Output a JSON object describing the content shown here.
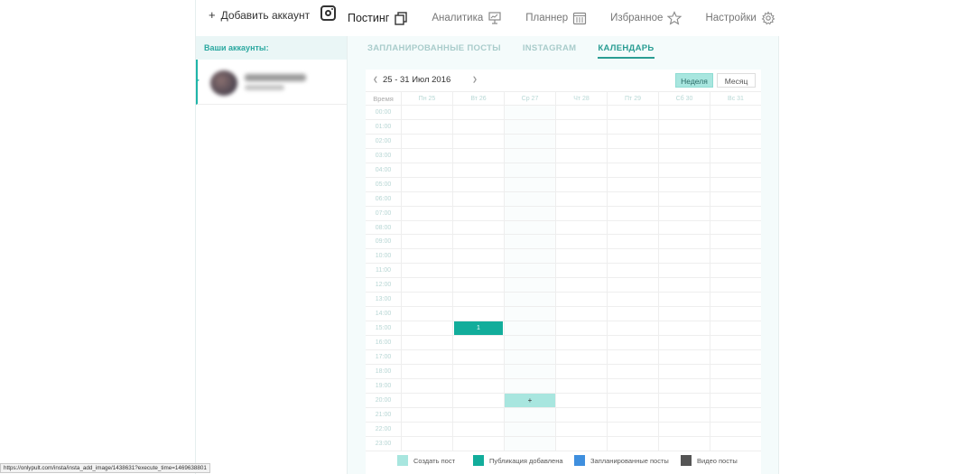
{
  "header": {
    "add_account_icon": "plus-icon",
    "add_account_label": "Добавить аккаунт",
    "instagram_icon": "instagram-icon",
    "nav": [
      {
        "label": "Постинг",
        "icon": "copy-icon",
        "active": true
      },
      {
        "label": "Аналитика",
        "icon": "presentation-icon",
        "active": false
      },
      {
        "label": "Планнер",
        "icon": "calendar-icon",
        "active": false
      },
      {
        "label": "Избранное",
        "icon": "star-icon",
        "active": false
      },
      {
        "label": "Настройки",
        "icon": "gear-icon",
        "active": false
      }
    ]
  },
  "sidebar": {
    "title": "Ваши аккаунты:"
  },
  "subtabs": [
    {
      "label": "ЗАПЛАНИРОВАННЫЕ ПОСТЫ",
      "active": false
    },
    {
      "label": "INSTAGRAM",
      "active": false
    },
    {
      "label": "КАЛЕНДАРЬ",
      "active": true
    }
  ],
  "calendar": {
    "range": "25 - 31 Июл 2016",
    "prev_icon": "chevron-left-icon",
    "next_icon": "chevron-right-icon",
    "week_label": "Неделя",
    "month_label": "Месяц",
    "time_header": "Время",
    "days": [
      "Пн 25",
      "Вт 26",
      "Ср 27",
      "Чт 28",
      "Пт 29",
      "Сб 30",
      "Вс 31"
    ],
    "hours": [
      "00:00",
      "01:00",
      "02:00",
      "03:00",
      "04:00",
      "05:00",
      "06:00",
      "07:00",
      "08:00",
      "09:00",
      "10:00",
      "11:00",
      "12:00",
      "13:00",
      "14:00",
      "15:00",
      "16:00",
      "17:00",
      "18:00",
      "19:00",
      "20:00",
      "21:00",
      "22:00",
      "23:00"
    ],
    "today_index": 2,
    "events": [
      {
        "day_index": 1,
        "hour_index": 15,
        "label": "1",
        "kind": "published"
      }
    ],
    "create_slot": {
      "day_index": 2,
      "hour_index": 20,
      "label": "+"
    }
  },
  "legend": [
    {
      "label": "Создать пост",
      "color": "#a8e6df"
    },
    {
      "label": "Публикация добавлена",
      "color": "#12ad9b"
    },
    {
      "label": "Запланированные посты",
      "color": "#3f8fde"
    },
    {
      "label": "Видео посты",
      "color": "#555555"
    }
  ],
  "status_url": "https://onlypult.com/insta/insta_add_image/1438631?execute_time=1469638801"
}
